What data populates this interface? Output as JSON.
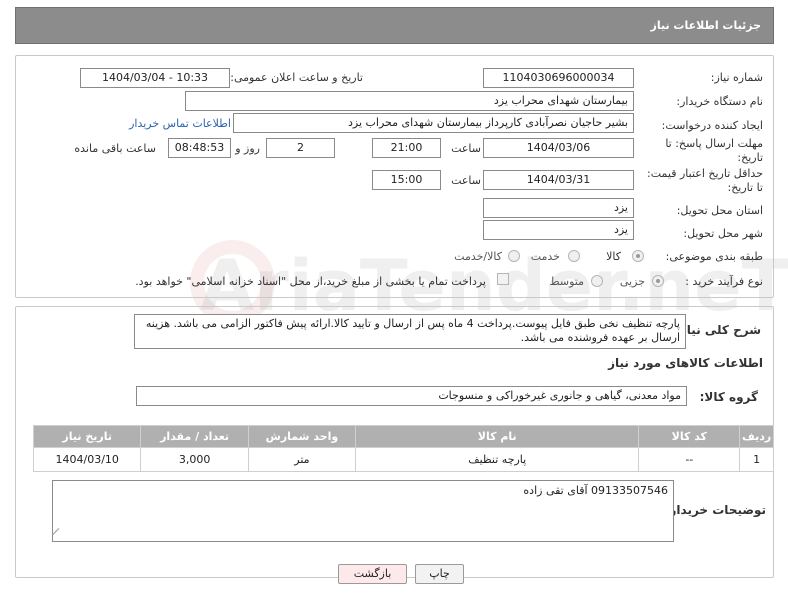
{
  "header": {
    "title": "جزئیات اطلاعات نیاز"
  },
  "fields": {
    "need_number_label": "شماره نیاز:",
    "need_number": "1104030696000034",
    "announce_label": "تاریخ و ساعت اعلان عمومی:",
    "announce_value": "1404/03/04 - 10:33",
    "buyer_org_label": "نام دستگاه خریدار:",
    "buyer_org": "بیمارستان شهدای محراب یزد",
    "requester_label": "ایجاد کننده درخواست:",
    "requester": "بشیر حاجیان نصرآبادی کارپرداز بیمارستان شهدای محراب یزد",
    "contact_link": "اطلاعات تماس خریدار",
    "reply_deadline_label": "مهلت ارسال پاسخ: تا تاریخ:",
    "reply_date": "1404/03/06",
    "time_label": "ساعت",
    "reply_time": "21:00",
    "days_value": "2",
    "days_label": "روز و",
    "remaining_time": "08:48:53",
    "remaining_label": "ساعت باقی مانده",
    "price_validity_label": "حداقل تاریخ اعتبار قیمت: تا تاریخ:",
    "price_date": "1404/03/31",
    "price_time_label": "ساعت",
    "price_time": "15:00",
    "province_label": "استان محل تحویل:",
    "province": "یزد",
    "city_label": "شهر محل تحویل:",
    "city": "یزد",
    "category_label": "طبقه بندی موضوعی:",
    "category_options": [
      "کالا",
      "خدمت",
      "کالا/خدمت"
    ],
    "process_label": "نوع فرآیند خرید :",
    "process_options": [
      "جزیی",
      "متوسط"
    ],
    "payment_note": "پرداخت تمام یا بخشی از مبلغ خرید،از محل \"اسناد خزانه اسلامی\" خواهد بود."
  },
  "description": {
    "label": "شرح کلی نیاز:",
    "text": "پارچه تنظیف نخی طبق فایل پیوست.پرداخت 4 ماه پس از ارسال و تایید کالا.ارائه پیش فاکتور الزامی می باشد. هزینه ارسال بر عهده فروشنده می باشد."
  },
  "goods_section": {
    "title": "اطلاعات کالاهای مورد نیاز",
    "group_label": "گروه کالا:",
    "group_value": "مواد معدنی، گیاهی و جانوری غیرخوراکی و منسوجات"
  },
  "table": {
    "headers": [
      "ردیف",
      "کد کالا",
      "نام کالا",
      "واحد شمارش",
      "تعداد / مقدار",
      "تاریخ نیاز"
    ],
    "rows": [
      [
        "1",
        "--",
        "پارچه تنظیف",
        "متر",
        "3,000",
        "1404/03/10"
      ]
    ]
  },
  "buyer_notes": {
    "label": "توضیحات خریدار:",
    "text": "09133507546 آقای تقی زاده"
  },
  "buttons": {
    "print": "چاپ",
    "back": "بازگشت"
  },
  "watermark": {
    "text": "AriaTender.neT"
  },
  "colors": {
    "header_bg": "#8c8c8c",
    "table_header_bg": "#b0b0b0",
    "link": "#2b63b0",
    "back_button_bg": "#fde9e9"
  }
}
